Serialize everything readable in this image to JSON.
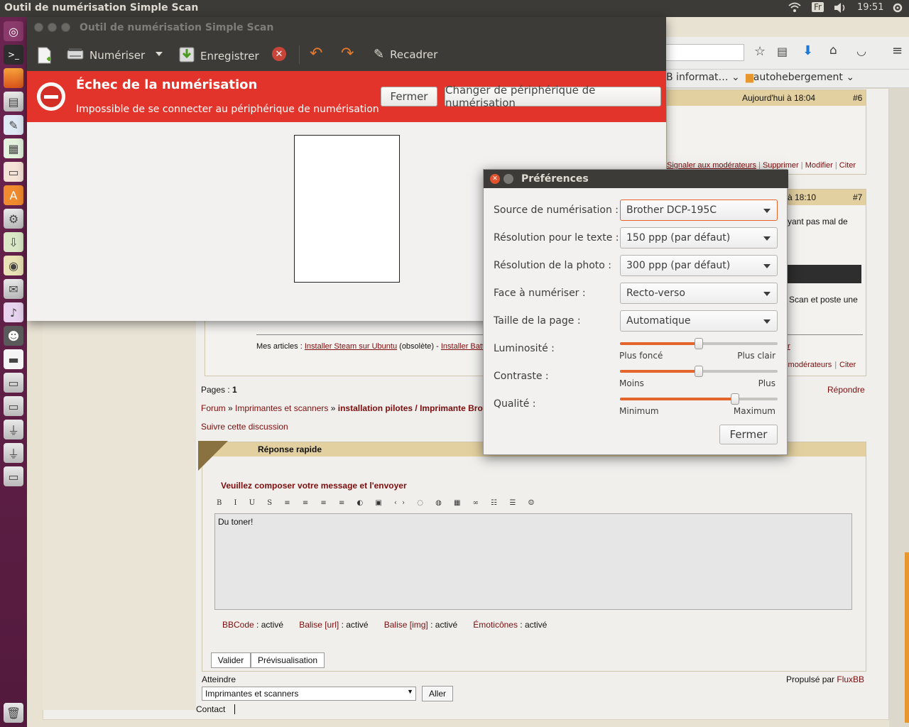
{
  "topbar": {
    "title": "Outil de numérisation Simple Scan",
    "keyboard": "Fr",
    "clock": "19:51"
  },
  "browser": {
    "bookmarks": [
      "B informat…",
      "autohebergement"
    ],
    "post6": {
      "date": "Aujourd'hui à 18:04",
      "num": "#6",
      "actions": [
        "Signaler aux modérateurs",
        "Supprimer",
        "Modifier",
        "Citer"
      ]
    },
    "post7": {
      "date": "à 18:10",
      "num": "#7",
      "text1": "yant pas mal de",
      "text2": "Scan et poste une",
      "link_r": "r",
      "actions": [
        "x modérateurs",
        "Citer"
      ]
    },
    "articles": {
      "label": "Mes articles : ",
      "link1": "Installer Steam sur Ubuntu",
      "mid": " (obsolète) - ",
      "link2": "Installer Batt"
    },
    "pages_label": "Pages : ",
    "pages_num": "1",
    "repondre": "Répondre",
    "breadcrumb": {
      "forum": "Forum",
      "sep1": " » ",
      "cat": "Imprimantes et scanners",
      "sep2": " » ",
      "topic": "installation pilotes / Imprimante Brot"
    },
    "suivre": "Suivre cette discussion",
    "reply_header": "Réponse rapide",
    "compose_hint": "Veuillez composer votre message et l'envoyer",
    "message": "Du toner!",
    "status": [
      {
        "name": "BBCode",
        "value": " : activé"
      },
      {
        "name": "Balise [url]",
        "value": " : activé"
      },
      {
        "name": "Balise [img]",
        "value": " : activé"
      },
      {
        "name": "Émoticônes",
        "value": " : activé"
      }
    ],
    "valider": "Valider",
    "preview": "Prévisualisation",
    "atteindre": "Atteindre",
    "jump_selected": "Imprimantes et scanners",
    "aller": "Aller",
    "powered_label": "Propulsé par ",
    "powered_link": "FluxBB",
    "contact": "Contact"
  },
  "scan": {
    "window_title": "Outil de numérisation Simple Scan",
    "toolbar": {
      "scan": "Numériser",
      "save": "Enregistrer",
      "crop": "Recadrer"
    },
    "error_title": "Échec de la numérisation",
    "error_msg": "Impossible de se connecter au périphérique de numérisation",
    "close_btn": "Fermer",
    "change_btn": "Changer de périphérique de numérisation"
  },
  "prefs": {
    "title": "Préférences",
    "labels": {
      "source": "Source de numérisation :",
      "text_res": "Résolution pour le texte :",
      "photo_res": "Résolution de la photo :",
      "side": "Face à numériser :",
      "page_size": "Taille de la page :",
      "brightness": "Luminosité :",
      "contrast": "Contraste :",
      "quality": "Qualité :"
    },
    "values": {
      "source": "Brother DCP-195C",
      "text_res": "150 ppp (par défaut)",
      "photo_res": "300 ppp (par défaut)",
      "side": "Recto-verso",
      "page_size": "Automatique"
    },
    "ticks": {
      "brightness_min": "Plus foncé",
      "brightness_max": "Plus clair",
      "contrast_min": "Moins",
      "contrast_max": "Plus",
      "quality_min": "Minimum",
      "quality_max": "Maximum"
    },
    "levels": {
      "brightness": 0.5,
      "contrast": 0.5,
      "quality": 0.73
    },
    "close": "Fermer"
  },
  "colors": {
    "accent": "#e3652b",
    "error_bar": "#e3342b",
    "launcher": "#5e1f47",
    "forum_link": "#7c0d0d"
  }
}
